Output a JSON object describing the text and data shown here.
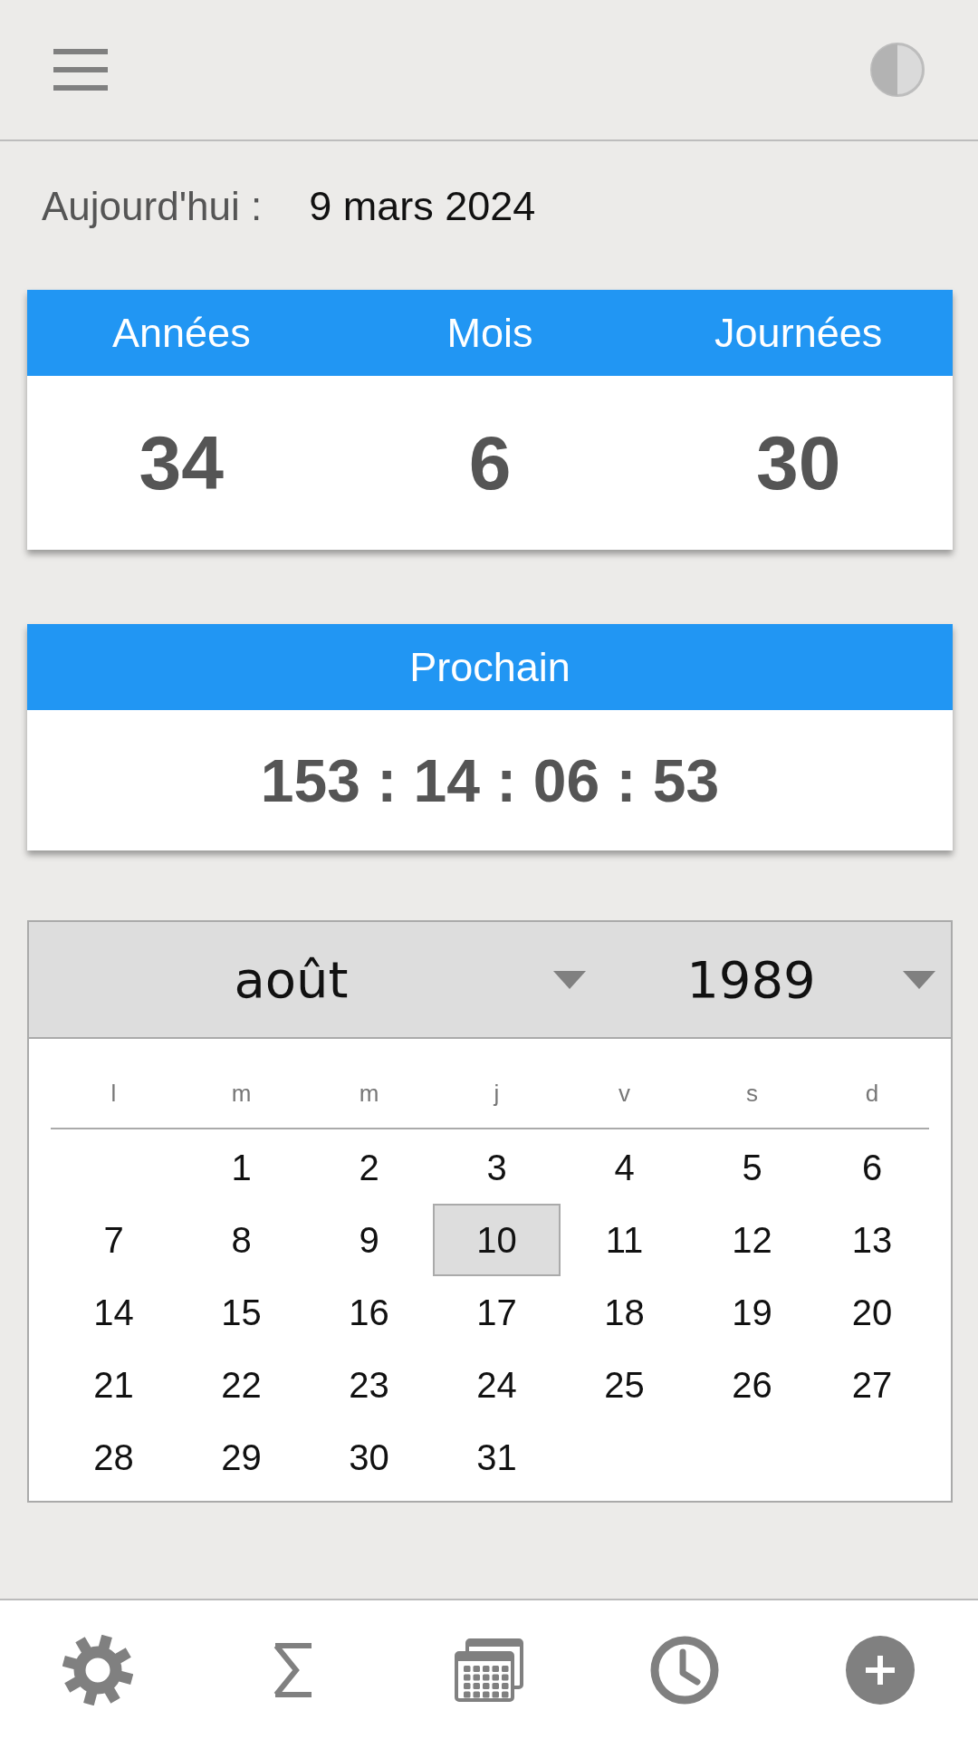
{
  "today": {
    "label": "Aujourd'hui :",
    "date": "9 mars 2024"
  },
  "age_card": {
    "columns": [
      {
        "label": "Années",
        "value": "34"
      },
      {
        "label": "Mois",
        "value": "6"
      },
      {
        "label": "Journées",
        "value": "30"
      }
    ]
  },
  "next_card": {
    "title": "Prochain",
    "countdown": "153 : 14 : 06 : 53"
  },
  "calendar": {
    "month": "août",
    "year": "1989",
    "weekdays": [
      "l",
      "m",
      "m",
      "j",
      "v",
      "s",
      "d"
    ],
    "weeks": [
      [
        {
          "kind": "empty"
        },
        {
          "kind": "day",
          "day": "1",
          "selected": false
        },
        {
          "kind": "day",
          "day": "2",
          "selected": false
        },
        {
          "kind": "day",
          "day": "3",
          "selected": false
        },
        {
          "kind": "day",
          "day": "4",
          "selected": false
        },
        {
          "kind": "day",
          "day": "5",
          "selected": false
        },
        {
          "kind": "day",
          "day": "6",
          "selected": false
        }
      ],
      [
        {
          "kind": "day",
          "day": "7",
          "selected": false
        },
        {
          "kind": "day",
          "day": "8",
          "selected": false
        },
        {
          "kind": "day",
          "day": "9",
          "selected": false
        },
        {
          "kind": "day",
          "day": "10",
          "selected": true
        },
        {
          "kind": "day",
          "day": "11",
          "selected": false
        },
        {
          "kind": "day",
          "day": "12",
          "selected": false
        },
        {
          "kind": "day",
          "day": "13",
          "selected": false
        }
      ],
      [
        {
          "kind": "day",
          "day": "14",
          "selected": false
        },
        {
          "kind": "day",
          "day": "15",
          "selected": false
        },
        {
          "kind": "day",
          "day": "16",
          "selected": false
        },
        {
          "kind": "day",
          "day": "17",
          "selected": false
        },
        {
          "kind": "day",
          "day": "18",
          "selected": false
        },
        {
          "kind": "day",
          "day": "19",
          "selected": false
        },
        {
          "kind": "day",
          "day": "20",
          "selected": false
        }
      ],
      [
        {
          "kind": "day",
          "day": "21",
          "selected": false
        },
        {
          "kind": "day",
          "day": "22",
          "selected": false
        },
        {
          "kind": "day",
          "day": "23",
          "selected": false
        },
        {
          "kind": "day",
          "day": "24",
          "selected": false
        },
        {
          "kind": "day",
          "day": "25",
          "selected": false
        },
        {
          "kind": "day",
          "day": "26",
          "selected": false
        },
        {
          "kind": "day",
          "day": "27",
          "selected": false
        }
      ],
      [
        {
          "kind": "day",
          "day": "28",
          "selected": false
        },
        {
          "kind": "day",
          "day": "29",
          "selected": false
        },
        {
          "kind": "day",
          "day": "30",
          "selected": false
        },
        {
          "kind": "day",
          "day": "31",
          "selected": false
        }
      ]
    ]
  }
}
